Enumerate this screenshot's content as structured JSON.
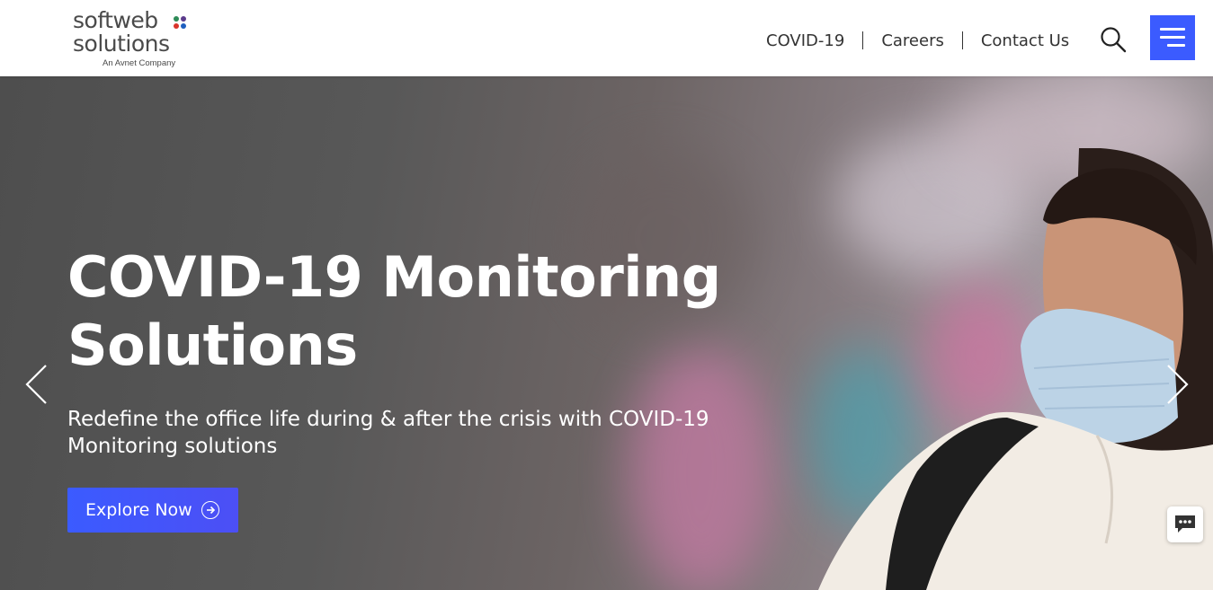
{
  "header": {
    "logo": {
      "line1": "softweb",
      "line2": "solutions",
      "tagline": "An Avnet Company",
      "dot_colors": [
        "#2e8b57",
        "#5b3b8c",
        "#d9342b",
        "#1f5fbf"
      ]
    },
    "nav": [
      {
        "label": "COVID-19"
      },
      {
        "label": "Careers"
      },
      {
        "label": "Contact Us"
      }
    ],
    "search_icon": "search-icon",
    "menu_icon": "hamburger-menu-icon"
  },
  "hero": {
    "title": "COVID-19 Monitoring Solutions",
    "subtitle": "Redefine the office life during & after the crisis with COVID-19 Monitoring solutions",
    "cta_label": "Explore Now",
    "cta_icon": "arrow-right-circle-icon",
    "prev_icon": "chevron-left-icon",
    "next_icon": "chevron-right-icon"
  },
  "chat_icon": "chat-bubble-icon",
  "colors": {
    "accent": "#3b5bff",
    "header_bg": "#ffffff",
    "nav_text": "#333333",
    "hero_text": "#ffffff"
  }
}
